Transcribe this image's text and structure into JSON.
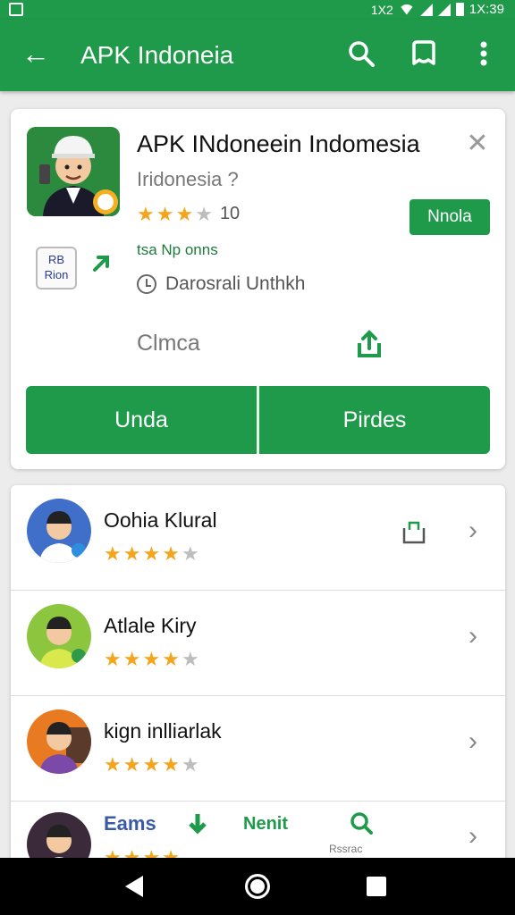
{
  "status_bar": {
    "time": "1X:39",
    "left_label": "1X2"
  },
  "app_bar": {
    "title": "APK Indoneia",
    "icons": [
      "back-arrow-icon",
      "search-icon",
      "bookmark-icon",
      "more-vert-icon"
    ]
  },
  "app_detail": {
    "name": "APK INdoneein Indomesia",
    "developer": "Iridonesia ?",
    "rating_value": "10",
    "rating_stars": 3.5,
    "install_label": "Nnola",
    "badge_text": "RB\nRion",
    "tagline": "tsa Np onns",
    "info_text": "Darosrali Unthkh",
    "category": "Clmca",
    "primary_button": "Unda",
    "secondary_button": "Pirdes"
  },
  "list": {
    "items": [
      {
        "name": "Oohia Klural",
        "stars": 4,
        "avatar_bg": "#3f6fc9",
        "trailing_icon": "bag-icon"
      },
      {
        "name": "Atlale Kiry",
        "stars": 4,
        "avatar_bg": "#8cc63f",
        "trailing_icon": ""
      },
      {
        "name": "kign inlliarlak",
        "stars": 4,
        "avatar_bg": "#e87a22",
        "trailing_icon": ""
      }
    ],
    "footer": {
      "label_blue": "Eams",
      "label_green": "Nenit",
      "small_text": "Rssrac"
    }
  },
  "colors": {
    "primary": "#1e9a4a",
    "star": "#f4a51c",
    "star_off": "#bdbdbd"
  }
}
